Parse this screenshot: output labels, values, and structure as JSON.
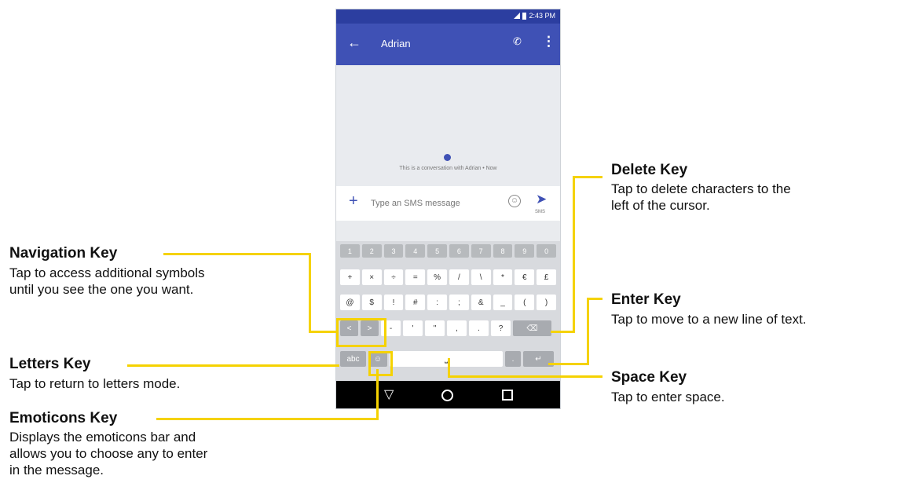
{
  "status_bar": {
    "time": "2:43 PM"
  },
  "app_bar": {
    "contact_name": "Adrian"
  },
  "conversation": {
    "note": "This is a conversation with Adrian • Now"
  },
  "compose": {
    "placeholder": "Type an SMS message",
    "send_label": "SMS"
  },
  "keyboard": {
    "number_row": [
      "1",
      "2",
      "3",
      "4",
      "5",
      "6",
      "7",
      "8",
      "9",
      "0"
    ],
    "symbol_row_1": [
      "+",
      "×",
      "÷",
      "=",
      "%",
      "/",
      "\\",
      "*",
      "€",
      "£"
    ],
    "symbol_row_2": [
      "@",
      "$",
      "!",
      "#",
      ":",
      ";",
      "&",
      "_",
      "(",
      ")"
    ],
    "symbol_row_3": [
      "-",
      "'",
      "\"",
      ",",
      ".",
      "?"
    ],
    "letters_key": "abc",
    "period_key": "."
  },
  "callouts": {
    "delete": {
      "title": "Delete Key",
      "desc_1": "Tap to delete characters to the",
      "desc_2": "left of the cursor."
    },
    "navigation": {
      "title": "Navigation Key",
      "desc_1": "Tap to access additional symbols",
      "desc_2": "until you see the one you want."
    },
    "enter": {
      "title": "Enter Key",
      "desc_1": "Tap to move to a new line of text."
    },
    "letters": {
      "title": "Letters Key",
      "desc_1": "Tap to return to letters mode."
    },
    "space": {
      "title": "Space Key",
      "desc_1": "Tap to enter space."
    },
    "emoticons": {
      "title": "Emoticons Key",
      "desc_1": "Displays the emoticons bar and",
      "desc_2": "allows you to choose any to enter",
      "desc_3": "in the message."
    }
  },
  "colors": {
    "app_bar": "#3f51b5",
    "status_bar": "#2c3ea0",
    "callout_line": "#f5d200"
  },
  "icons": [
    "back-arrow-icon",
    "phone-icon",
    "more-vert-icon",
    "plus-icon",
    "emoji-icon",
    "send-icon",
    "signal-icon",
    "battery-icon",
    "delete-icon",
    "enter-icon",
    "space-icon",
    "left-arrow-icon",
    "right-arrow-icon",
    "back-nav-icon",
    "home-nav-icon",
    "recent-apps-icon"
  ]
}
